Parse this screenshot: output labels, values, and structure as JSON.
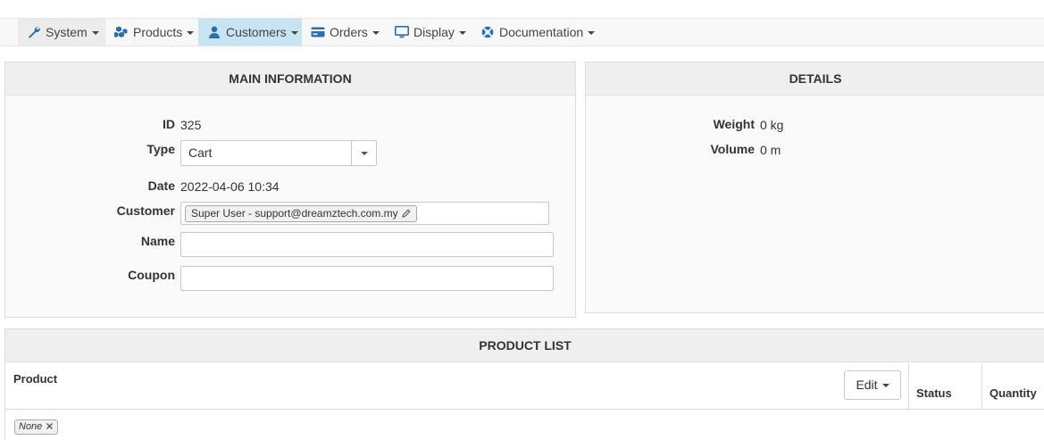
{
  "nav": {
    "items": [
      {
        "label": "System",
        "icon": "wrench-icon"
      },
      {
        "label": "Products",
        "icon": "cubes-icon"
      },
      {
        "label": "Customers",
        "icon": "user-icon"
      },
      {
        "label": "Orders",
        "icon": "credit-card-icon"
      },
      {
        "label": "Display",
        "icon": "monitor-icon"
      },
      {
        "label": "Documentation",
        "icon": "lifebuoy-icon"
      }
    ],
    "active": "Customers"
  },
  "main_info": {
    "title": "MAIN INFORMATION",
    "id_label": "ID",
    "id_value": "325",
    "type_label": "Type",
    "type_value": "Cart",
    "date_label": "Date",
    "date_value": "2022-04-06 10:34",
    "customer_label": "Customer",
    "customer_value": "Super User - support@dreamztech.com.my",
    "name_label": "Name",
    "name_value": "",
    "coupon_label": "Coupon",
    "coupon_value": ""
  },
  "details": {
    "title": "DETAILS",
    "weight_label": "Weight",
    "weight_value": "0 kg",
    "volume_label": "Volume",
    "volume_value": "0 m"
  },
  "product_list": {
    "title": "PRODUCT LIST",
    "columns": {
      "product": "Product",
      "status": "Status",
      "quantity": "Quantity"
    },
    "edit_label": "Edit",
    "filter_tag": "None"
  },
  "colors": {
    "active_nav": "#c8e3f2",
    "icon_blue": "#2f6fa8",
    "panel_head": "#efefef"
  }
}
